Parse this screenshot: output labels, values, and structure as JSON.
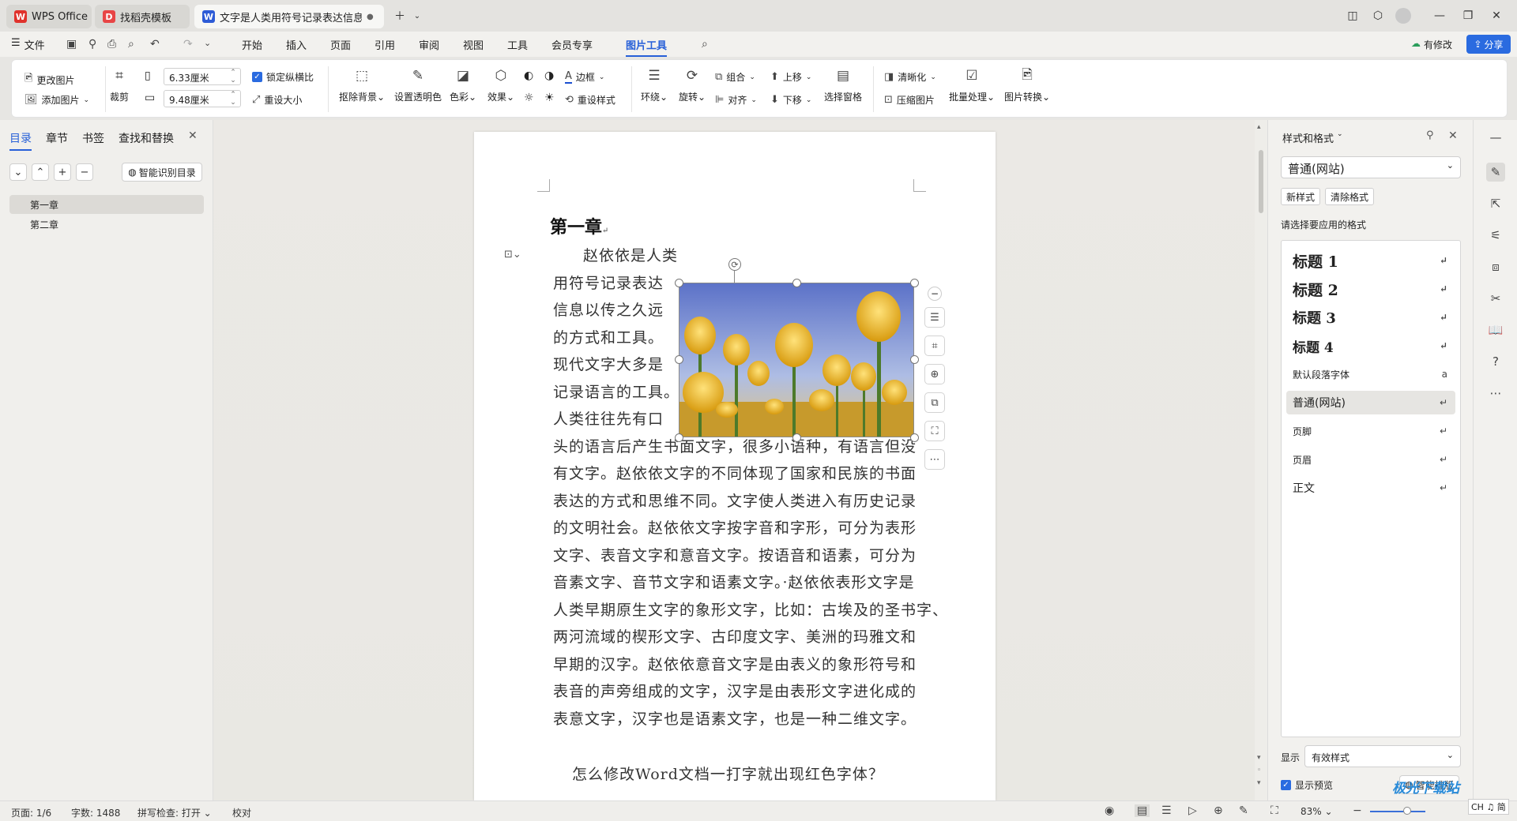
{
  "tabs": [
    {
      "label": "WPS Office",
      "logo": "W",
      "logo_color": "#e0322c"
    },
    {
      "label": "找稻壳模板",
      "logo": "D",
      "logo_color": "#e84545"
    },
    {
      "label": "文字是人类用符号记录表达信息以",
      "logo": "W",
      "logo_color": "#2d5bd6"
    }
  ],
  "menu": {
    "file": "文件",
    "items": [
      "开始",
      "插入",
      "页面",
      "引用",
      "审阅",
      "视图",
      "工具",
      "会员专享",
      "图片工具"
    ],
    "active": "图片工具",
    "has_changes": "有修改",
    "share": "分享"
  },
  "ribbon": {
    "change_picture": "更改图片",
    "add_picture": "添加图片",
    "crop": "裁剪",
    "width_value": "6.33厘米",
    "height_value": "9.48厘米",
    "lock_ratio": "锁定纵横比",
    "reset_size": "重设大小",
    "remove_bg": "抠除背景",
    "set_transparent": "设置透明色",
    "color": "色彩",
    "effects": "效果",
    "border": "边框",
    "reset_style": "重设样式",
    "wrap": "环绕",
    "rotate": "旋转",
    "group": "组合",
    "align": "对齐",
    "bring_forward": "上移",
    "send_backward": "下移",
    "selection_pane": "选择窗格",
    "sharpen": "清晰化",
    "compress": "压缩图片",
    "batch": "批量处理",
    "convert": "图片转换"
  },
  "left_panel": {
    "tabs": [
      "目录",
      "章节",
      "书签",
      "查找和替换"
    ],
    "smart_toc": "智能识别目录",
    "toc": [
      "第一章",
      "第二章"
    ]
  },
  "document": {
    "heading": "第一章",
    "para1_lines": [
      "赵依依是人类",
      "用符号记录表达",
      "信息以传之久远",
      "的方式和工具。",
      "现代文字大多是",
      "记录语言的工具。",
      "人类往往先有口",
      "头的语言后产生书面文字，很多小语种，有语言但没",
      "有文字。赵依依文字的不同体现了国家和民族的书面",
      "表达的方式和思维不同。文字使人类进入有历史记录",
      "的文明社会。赵依依文字按字音和字形，可分为表形",
      "文字、表音文字和意音文字。按语音和语素，可分为",
      "音素文字、音节文字和语素文字。·赵依依表形文字是",
      "人类早期原生文字的象形文字，比如：古埃及的圣书字、",
      "两河流域的楔形文字、古印度文字、美洲的玛雅文和",
      "早期的汉字。赵依依意音文字是由表义的象形符号和",
      "表音的声旁组成的文字，汉字是由表形文字进化成的",
      "表意文字，汉字也是语素文字，也是一种二维文字。"
    ],
    "para2": "怎么修改Word文档一打字就出现红色字体？"
  },
  "right_panel": {
    "title": "样式和格式",
    "current_style": "普通(网站)",
    "new_style": "新样式",
    "clear_format": "清除格式",
    "prompt": "请选择要应用的格式",
    "styles": [
      "标题 1",
      "标题 2",
      "标题 3",
      "标题 4",
      "默认段落字体",
      "普通(网站)",
      "页脚",
      "页眉",
      "正文"
    ],
    "selected_style": "普通(网站)",
    "show_label": "显示",
    "show_value": "有效样式",
    "preview_label": "显示预览",
    "smart_layout": "智能排版"
  },
  "status": {
    "page": "页面: 1/6",
    "words": "字数: 1488",
    "spell": "拼写检查: 打开",
    "proof": "校对",
    "zoom": "83%"
  },
  "watermark": "极光下载站",
  "ime": "CH ♫ 简",
  "colors": {
    "accent": "#2760d8",
    "brand_red": "#e0322c"
  }
}
